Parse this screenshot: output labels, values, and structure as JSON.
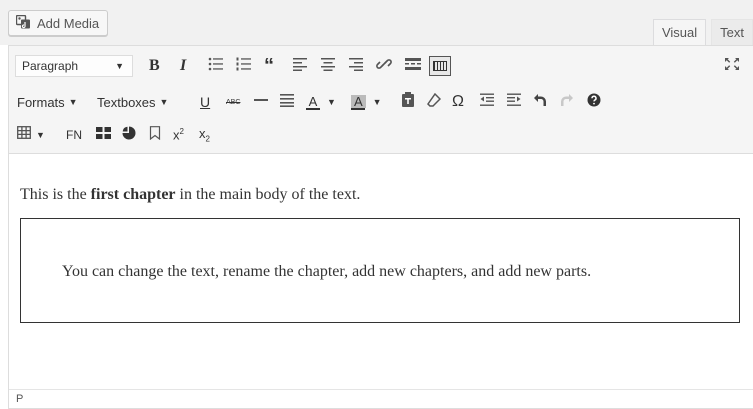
{
  "add_media": {
    "label": "Add Media",
    "icon": "media-icon"
  },
  "tabs": [
    {
      "label": "Visual",
      "active": true
    },
    {
      "label": "Text",
      "active": false
    }
  ],
  "toolbar": {
    "row1": {
      "format_select": "Paragraph",
      "icons": [
        "bold-icon",
        "italic-icon",
        "bulleted-list-icon",
        "numbered-list-icon",
        "blockquote-icon",
        "align-left-icon",
        "align-center-icon",
        "align-right-icon",
        "link-icon",
        "read-more-icon",
        "toolbar-toggle-icon",
        "fullscreen-icon"
      ]
    },
    "row2": {
      "formats_label": "Formats",
      "textboxes_label": "Textboxes",
      "icons": [
        "underline-icon",
        "strikethrough-icon",
        "horizontal-line-icon",
        "justify-icon",
        "text-color-icon",
        "background-color-icon",
        "paste-as-text-icon",
        "clear-formatting-icon",
        "special-character-icon",
        "outdent-icon",
        "indent-icon",
        "undo-icon",
        "redo-icon",
        "help-icon"
      ],
      "glyphs": {
        "underline": "U",
        "strike": "ABC",
        "text_color": "A",
        "bg_color": "A",
        "omega": "Ω"
      }
    },
    "row3": {
      "footnote_label": "FN",
      "icons": [
        "table-icon",
        "footnote-icon",
        "layout-icon",
        "chart-icon",
        "bookmark-icon",
        "superscript-icon",
        "subscript-icon"
      ]
    },
    "accent": "#333333"
  },
  "content": {
    "para_before": "This is the ",
    "para_bold": "first chapter",
    "para_after": " in the main body of the text.",
    "textbox_text": "You can change the text, rename the chapter, add new chapters, and add new parts."
  },
  "statusbar": {
    "path": "P"
  }
}
